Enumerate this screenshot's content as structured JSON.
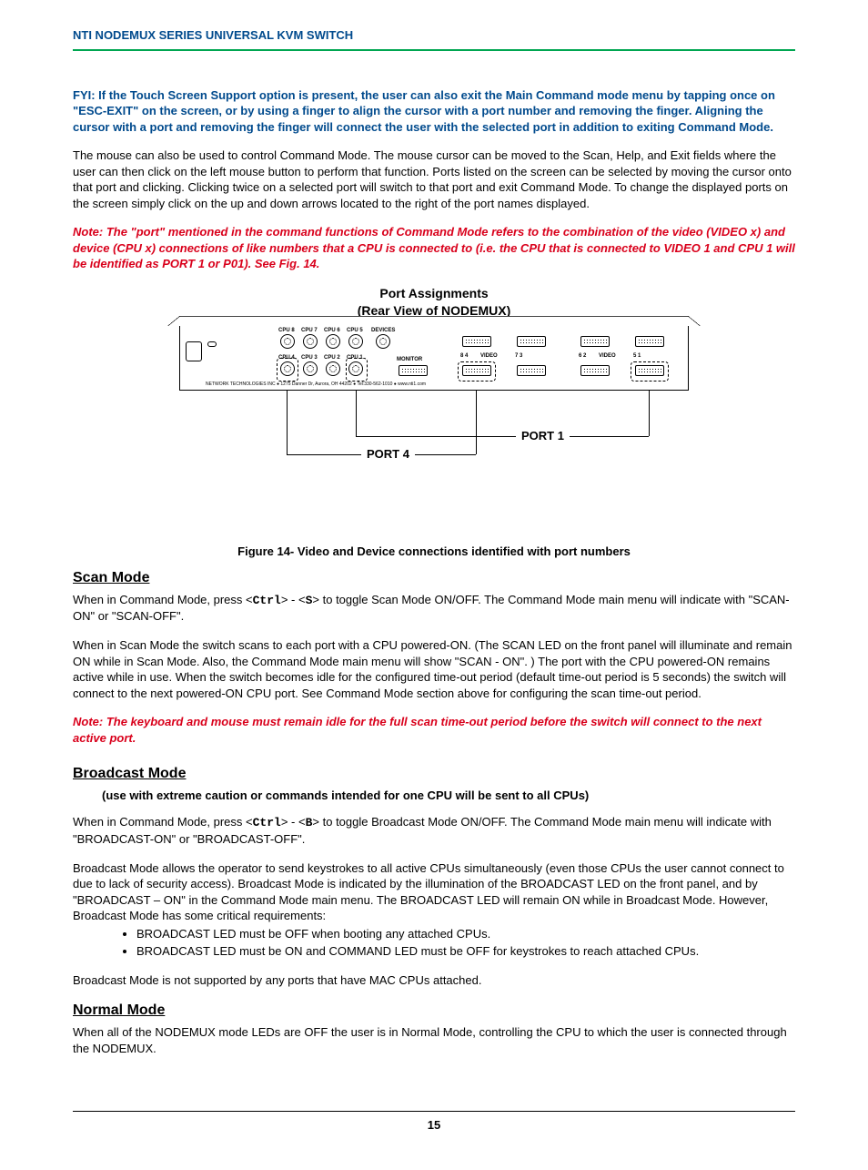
{
  "header": "NTI NODEMUX SERIES UNIVERSAL KVM SWITCH",
  "fyi": "FYI: If the Touch Screen Support option is present, the user can also exit the Main Command mode menu by tapping once on \"ESC-EXIT\" on the screen, or by using a finger to align the cursor with a port number and removing the finger. Aligning the cursor with a port and removing the finger will connect the user with the selected port in addition to exiting Command Mode.",
  "mouse_para": "The mouse can also be used to control Command Mode.  The mouse cursor can be moved to the Scan, Help, and Exit fields where the user can then click on the left mouse button to perform that function.   Ports listed on the screen can be selected by moving the cursor onto that port and clicking.  Clicking twice on a selected port will switch to that port and exit Command Mode.  To change the displayed ports on the screen simply click on the up and down arrows located to the right of the port names displayed.",
  "port_note": "Note:  The \"port\" mentioned in the command functions of Command Mode refers to the combination of the video (VIDEO x) and device (CPU x) connections of like numbers that a CPU is connected to  (i.e.  the CPU that is connected to VIDEO 1 and CPU 1 will be identified as PORT 1 or P01).   See Fig. 14.",
  "diagram": {
    "title1": "Port Assignments",
    "title2": "(Rear View of NODEMUX)",
    "labels": {
      "cpu8": "CPU 8",
      "cpu7": "CPU 7",
      "cpu6": "CPU 6",
      "cpu5": "CPU 5",
      "cpu4": "CPU 4",
      "cpu3": "CPU 3",
      "cpu2": "CPU 2",
      "cpu1": "CPU 1",
      "devices": "DEVICES",
      "monitor": "MONITOR",
      "v84": "8      4",
      "v73": "7      3",
      "v62": "6      2",
      "v51": "5      1",
      "video": "VIDEO",
      "port1": "PORT 1",
      "port4": "PORT 4",
      "footer": "NETWORK TECHNOLOGIES INC ● 1275 Danner Dr, Aurora, OH 44202 ● Tel:330-562-1010 ● www.nti1.com"
    },
    "caption": "Figure 14- Video and Device connections identified with port numbers"
  },
  "scan": {
    "h": "Scan Mode",
    "p1a": "When in Command Mode,   press <",
    "k1": "Ctrl",
    "p1b": "> - <",
    "k2": "S",
    "p1c": "> to toggle Scan Mode ON/OFF.  The Command Mode main menu will indicate with \"SCAN-ON\"  or   \"SCAN-OFF\".",
    "p2": "When in Scan Mode the switch scans to each port with a CPU powered-ON. (The SCAN LED on the front panel will illuminate and remain ON while in Scan Mode. Also, the Command Mode main menu will show \"SCAN - ON\". )  The port with the CPU powered-ON remains active while in use.  When the switch becomes idle for the configured time-out period (default time-out period is 5 seconds) the switch will connect to the next powered-ON CPU port. See Command Mode section above for configuring the scan time-out period.",
    "note": "Note: The keyboard and mouse must remain idle for the full scan time-out period before the switch will connect to the next active port."
  },
  "broadcast": {
    "h": "Broadcast Mode",
    "sub": "(use with extreme caution or commands intended for one CPU will be sent to all CPUs)",
    "p1a": "When in Command Mode,   press <",
    "k1": "Ctrl",
    "p1b": "> - <",
    "k2": "B",
    "p1c": "> to toggle Broadcast Mode ON/OFF.  The Command Mode main menu will indicate with \"BROADCAST-ON\"  or   \"BROADCAST-OFF\".",
    "p2": "Broadcast Mode allows the operator to send keystrokes to all active CPUs simultaneously (even those CPUs the user cannot connect to due to lack of security access).  Broadcast Mode is indicated by the illumination of the BROADCAST LED on the front panel, and by \"BROADCAST – ON\"  in the Command Mode main menu.    The BROADCAST LED will remain ON while in Broadcast Mode.   However, Broadcast Mode has some critical requirements:",
    "b1": "BROADCAST LED must be OFF when booting any attached CPUs.",
    "b2": "BROADCAST LED must be ON and COMMAND LED must be OFF for keystrokes to reach attached CPUs.",
    "p3": "Broadcast Mode is not supported by any ports that have MAC CPUs attached."
  },
  "normal": {
    "h": "Normal Mode",
    "p": "When all of the NODEMUX mode LEDs are OFF the user is in Normal Mode, controlling the CPU to which the user is connected through the NODEMUX."
  },
  "page": "15"
}
